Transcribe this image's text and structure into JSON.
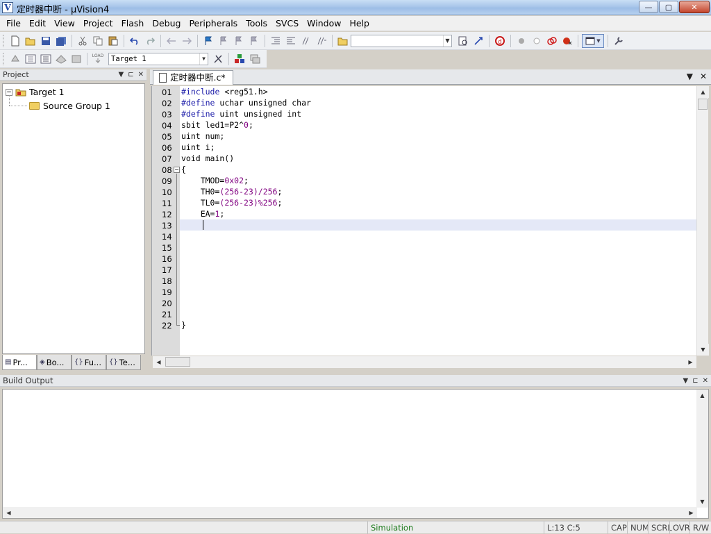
{
  "window": {
    "title": "定时器中断 - μVision4",
    "app_icon": "V",
    "controls": {
      "minimize": "—",
      "maximize": "▢",
      "close": "✕"
    }
  },
  "menu": [
    "File",
    "Edit",
    "View",
    "Project",
    "Flash",
    "Debug",
    "Peripherals",
    "Tools",
    "SVCS",
    "Window",
    "Help"
  ],
  "toolbar1": {
    "icons": [
      "new-file-icon",
      "open-folder-icon",
      "save-icon",
      "save-all-icon",
      "cut-icon",
      "copy-icon",
      "paste-icon",
      "undo-icon",
      "redo-icon",
      "navigate-back-icon",
      "navigate-forward-icon",
      "bookmark-icon",
      "prev-bookmark-icon",
      "next-bookmark-icon",
      "clear-bookmarks-icon",
      "indent-icon",
      "unindent-icon",
      "comment-icon",
      "uncomment-icon",
      "find-in-files-icon"
    ],
    "find_value": "",
    "icons_after": [
      "incremental-find-icon",
      "source-browse-icon",
      "debug-session-icon",
      "breakpoint-icon",
      "disable-breakpoint-icon",
      "disable-all-breakpoints-icon",
      "kill-all-breakpoints-icon",
      "window-layout-icon",
      "configure-icon"
    ]
  },
  "toolbar2": {
    "icons": [
      "translate-icon",
      "build-icon",
      "rebuild-icon",
      "batch-build-icon",
      "stop-build-icon",
      "download-icon"
    ],
    "download_label": "LOAD",
    "target_value": "Target 1",
    "icons_after": [
      "target-options-icon",
      "manage-components-icon",
      "select-packs-icon"
    ]
  },
  "project_panel": {
    "title": "Project",
    "controls": {
      "dropdown": "▼",
      "pin": "⊏",
      "close": "✕"
    },
    "tree": {
      "target": {
        "expander": "−",
        "label": "Target 1"
      },
      "group": {
        "label": "Source Group 1"
      }
    },
    "tabs": [
      {
        "icon": "project-tab-icon",
        "label": "Pr..."
      },
      {
        "icon": "books-tab-icon",
        "label": "Bo..."
      },
      {
        "icon": "functions-tab-icon",
        "label": "Fu..."
      },
      {
        "icon": "templates-tab-icon",
        "label": "Te..."
      }
    ],
    "tab_glyphs": [
      "▤",
      "◈",
      "{}",
      "{}"
    ]
  },
  "editor": {
    "tab_label": "定时器中断.c*",
    "controls": {
      "dropdown": "▼",
      "close": "✕"
    },
    "line_numbers": [
      "01",
      "02",
      "03",
      "04",
      "05",
      "06",
      "07",
      "08",
      "09",
      "10",
      "11",
      "12",
      "13",
      "14",
      "15",
      "16",
      "17",
      "18",
      "19",
      "20",
      "21",
      "22"
    ],
    "lines": {
      "l01": {
        "pre": "#include",
        "rest": " <reg51.h>"
      },
      "l02": {
        "pre": "#define",
        "rest": " uchar unsigned char"
      },
      "l03": {
        "pre": "#define",
        "rest": " uint unsigned int"
      },
      "l04": {
        "a": "sbit led1=P2^",
        "n": "0",
        "b": ";"
      },
      "l05": "uint num;",
      "l06": "uint i;",
      "l07": "void main()",
      "l08": "{",
      "l09": {
        "a": "    TMOD=",
        "n": "0x02",
        "b": ";"
      },
      "l10": {
        "a": "    TH0=",
        "n": "(256-23)/256",
        "b": ";"
      },
      "l11": {
        "a": "    TL0=",
        "n": "(256-23)%256",
        "b": ";"
      },
      "l12": {
        "a": "    EA=",
        "n": "1",
        "b": ";"
      },
      "l22": "}"
    },
    "fold_glyph": "−"
  },
  "scroll_glyphs": {
    "up": "▲",
    "down": "▼",
    "left": "◀",
    "right": "▶"
  },
  "build_output": {
    "title": "Build Output",
    "controls": {
      "dropdown": "▼",
      "pin": "⊏",
      "close": "✕"
    }
  },
  "statusbar": {
    "mode": "Simulation",
    "position": "L:13 C:5",
    "cap": "CAP",
    "num": "NUM",
    "scrl": "SCRL",
    "ovr": "OVR",
    "rw": "R/W"
  },
  "colors": {
    "preprocessor": "#1a1aa8",
    "number": "#800080",
    "current_line": "#e4e8f7",
    "simulation_text": "#1a7a1a"
  }
}
